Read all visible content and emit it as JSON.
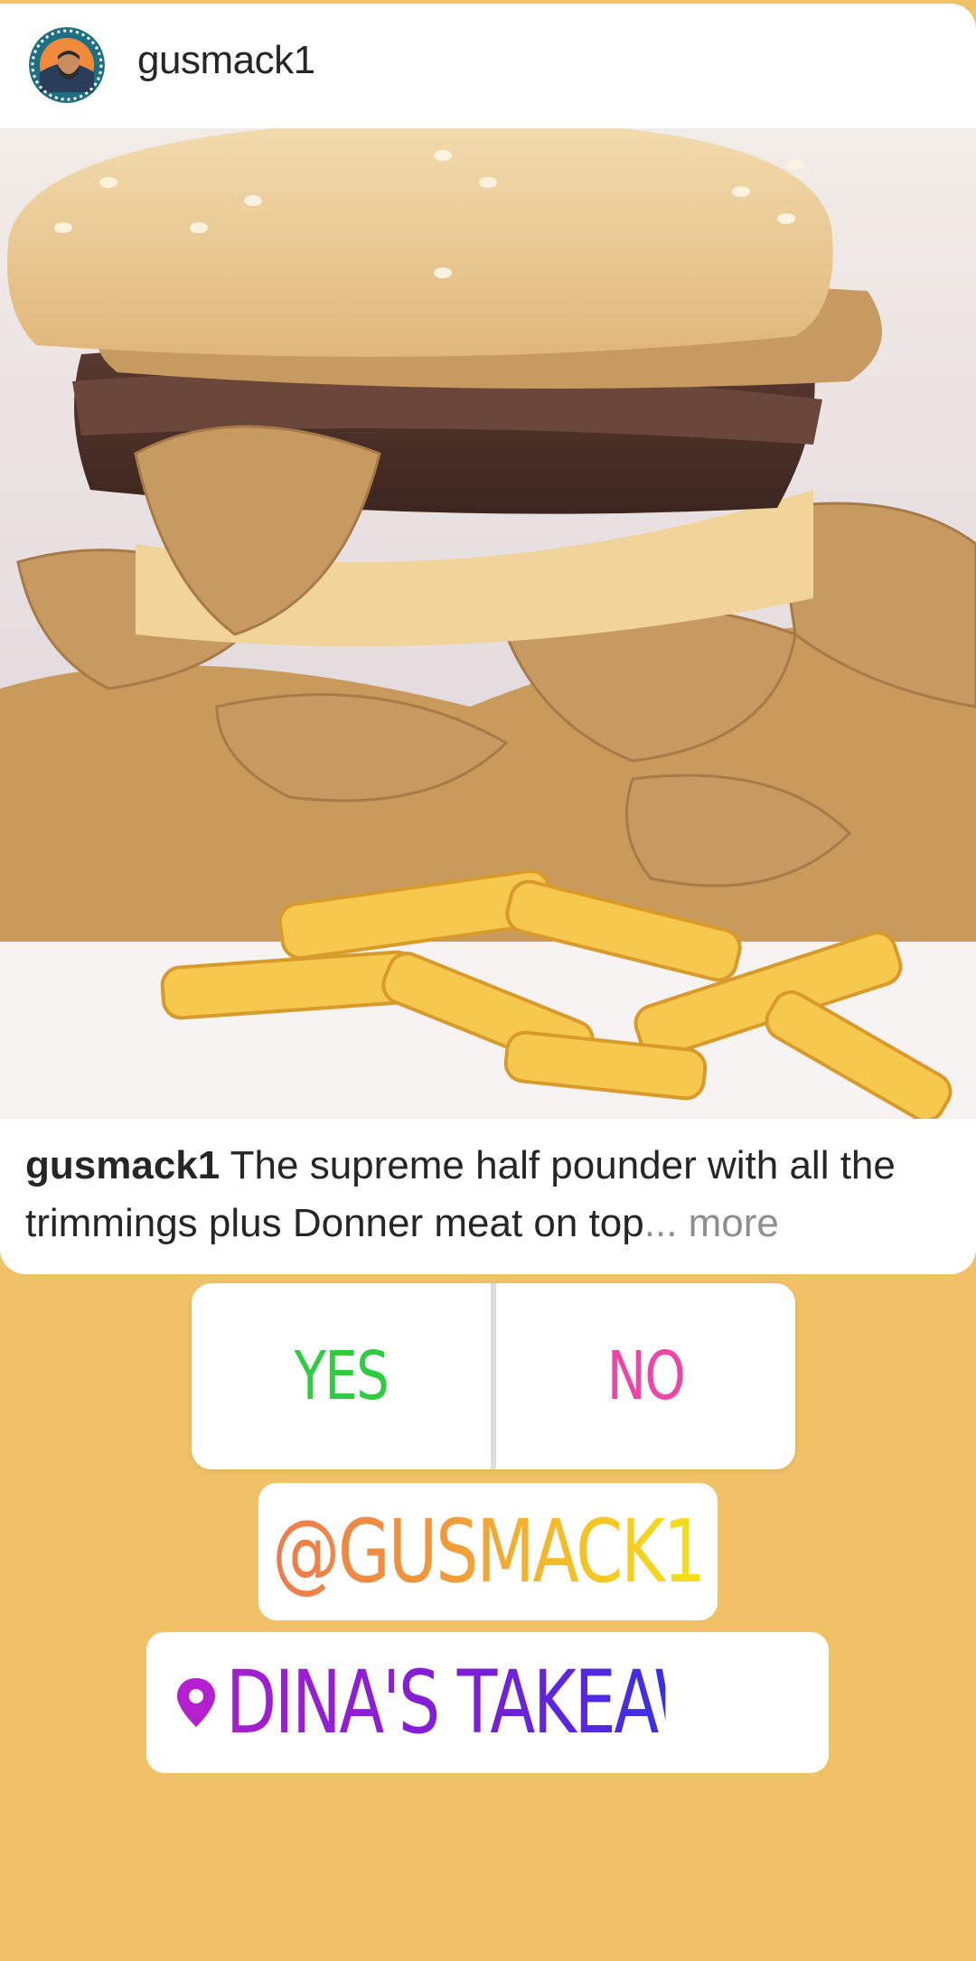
{
  "post": {
    "username": "gusmack1",
    "avatar_icon": "foodie-gusmack1-avatar",
    "caption": {
      "username": "gusmack1",
      "text": "The supreme half pounder with all the trimmings plus Donner meat on top",
      "more_label": "... more"
    }
  },
  "stickers": {
    "poll": {
      "yes_label": "YES",
      "no_label": "NO"
    },
    "mention": "@GUSMACK1",
    "location": {
      "icon": "location-pin-icon",
      "label": "DINA'S TAKEAWAY"
    }
  },
  "colors": {
    "background": "#f0c166",
    "yes": "#2ecc40",
    "no": "#ee45a8",
    "location": "#7c1ed8"
  }
}
